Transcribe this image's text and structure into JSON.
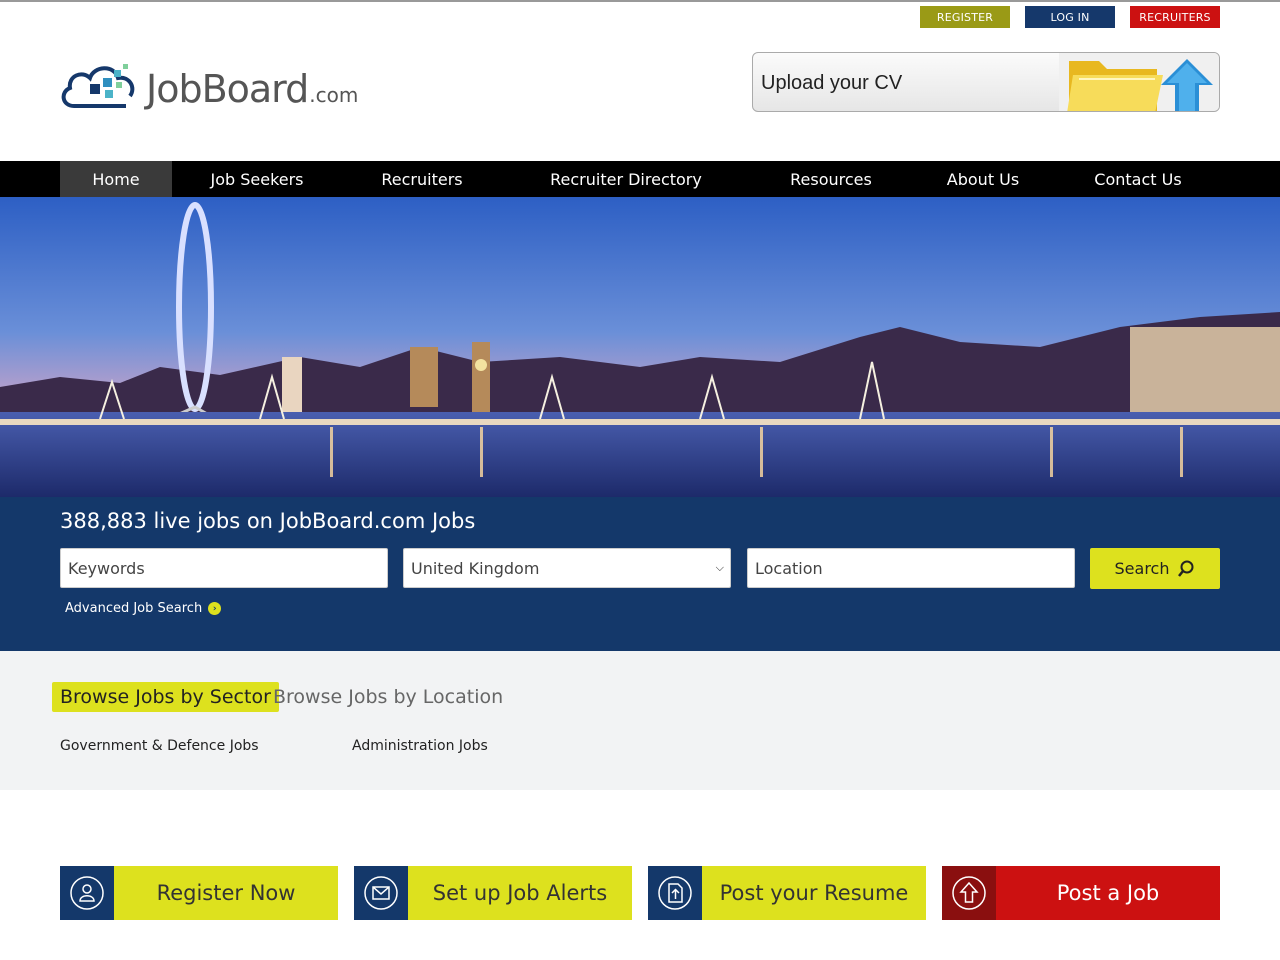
{
  "top_buttons": {
    "register": "REGISTER",
    "login": "LOG IN",
    "recruiters": "RECRUITERS"
  },
  "logo": {
    "name": "JobBoard",
    "domain": ".com"
  },
  "upload_cv": {
    "label": "Upload your CV"
  },
  "nav": {
    "items": [
      "Home",
      "Job Seekers",
      "Recruiters",
      "Recruiter Directory",
      "Resources",
      "About Us",
      "Contact Us"
    ],
    "active": "Home"
  },
  "search": {
    "headline": "388,883 live jobs on JobBoard.com Jobs",
    "keywords_placeholder": "Keywords",
    "country_selected": "United Kingdom",
    "location_placeholder": "Location",
    "search_label": "Search",
    "advanced_label": "Advanced Job Search"
  },
  "browse": {
    "tabs": [
      "Browse Jobs by Sector",
      "Browse Jobs by Location"
    ],
    "sectors": [
      "Government & Defence Jobs",
      "Administration Jobs"
    ]
  },
  "cta": [
    "Register Now",
    "Set up Job Alerts",
    "Post your Resume",
    "Post a Job"
  ],
  "colors": {
    "accent_yellow": "#dde11e",
    "navy": "#14386a",
    "red": "#cc1111",
    "olive": "#9a9a16"
  }
}
